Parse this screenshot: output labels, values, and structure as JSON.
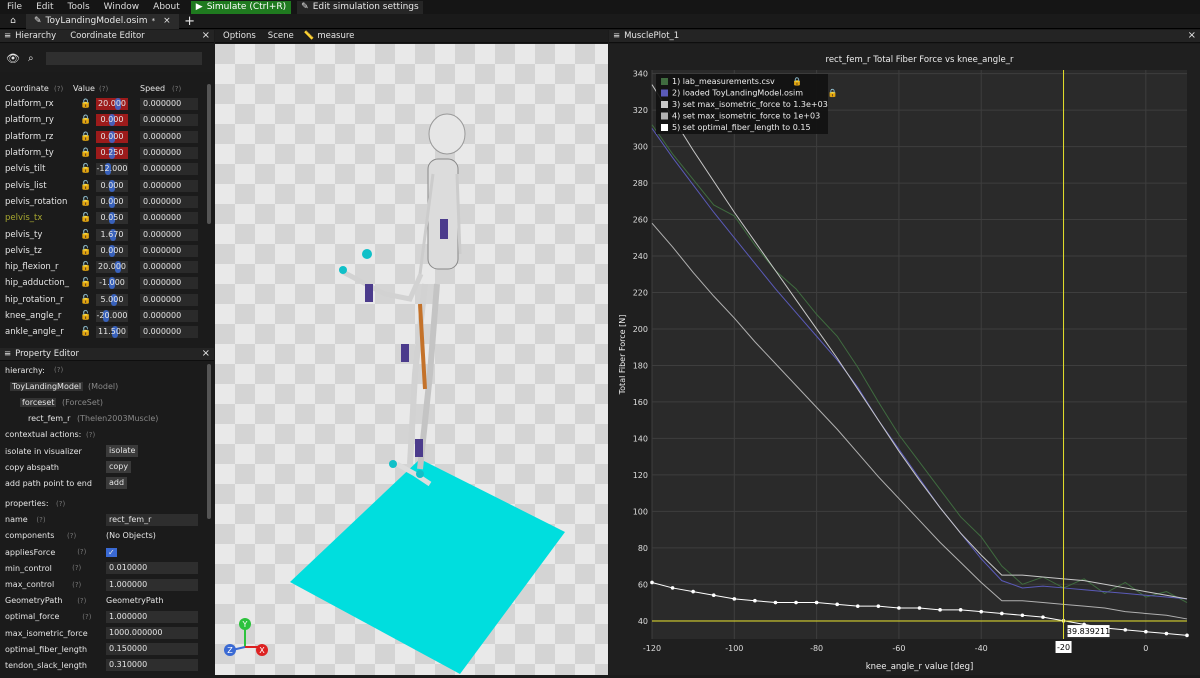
{
  "menu": {
    "items": [
      "File",
      "Edit",
      "Tools",
      "Window",
      "About"
    ],
    "simulate_label": "Simulate (Ctrl+R)",
    "edit_sim_label": "Edit simulation settings"
  },
  "tabs": {
    "file_tab": "ToyLandingModel.osim",
    "modified_mark": "*"
  },
  "hierarchy_panel": {
    "tab1": "Hierarchy",
    "tab2": "Coordinate Editor"
  },
  "coord_editor": {
    "headers": {
      "coordinate": "Coordinate",
      "value": "Value",
      "speed": "Speed",
      "help": "(?)"
    },
    "rows": [
      {
        "name": "platform_rx",
        "value": "20.000",
        "speed": "0.000000",
        "locked": true
      },
      {
        "name": "platform_ry",
        "value": "0.000",
        "speed": "0.000000",
        "locked": true
      },
      {
        "name": "platform_rz",
        "value": "0.000",
        "speed": "0.000000",
        "locked": true
      },
      {
        "name": "platform_ty",
        "value": "0.250",
        "speed": "0.000000",
        "locked": true
      },
      {
        "name": "pelvis_tilt",
        "value": "-12.000",
        "speed": "0.000000",
        "locked": false
      },
      {
        "name": "pelvis_list",
        "value": "0.000",
        "speed": "0.000000",
        "locked": false
      },
      {
        "name": "pelvis_rotation",
        "value": "0.000",
        "speed": "0.000000",
        "locked": false
      },
      {
        "name": "pelvis_tx",
        "value": "0.050",
        "speed": "0.000000",
        "locked": false
      },
      {
        "name": "pelvis_ty",
        "value": "1.670",
        "speed": "0.000000",
        "locked": false
      },
      {
        "name": "pelvis_tz",
        "value": "0.000",
        "speed": "0.000000",
        "locked": false
      },
      {
        "name": "hip_flexion_r",
        "value": "20.000",
        "speed": "0.000000",
        "locked": false
      },
      {
        "name": "hip_adduction_",
        "value": "-1.000",
        "speed": "0.000000",
        "locked": false
      },
      {
        "name": "hip_rotation_r",
        "value": "5.000",
        "speed": "0.000000",
        "locked": false
      },
      {
        "name": "knee_angle_r",
        "value": "-20.000",
        "speed": "0.000000",
        "locked": false
      },
      {
        "name": "ankle_angle_r",
        "value": "11.500",
        "speed": "0.000000",
        "locked": false
      }
    ],
    "colors": {
      "locked_bg": "#9c1b1b",
      "dimmed_name": "#a8a830"
    }
  },
  "property_editor": {
    "title": "Property Editor",
    "hierarchy_label": "hierarchy:",
    "h_model": "ToyLandingModel",
    "h_model_type": "(Model)",
    "h_forceset": "forceset",
    "h_forceset_type": "(ForceSet)",
    "h_muscle": "rect_fem_r",
    "h_muscle_type": "(Thelen2003Muscle)",
    "contextual_label": "contextual actions:",
    "isolate_label": "isolate in visualizer",
    "isolate_btn": "isolate",
    "copy_label": "copy abspath",
    "copy_btn": "copy",
    "addpath_label": "add path point to end",
    "add_btn": "add",
    "properties_label": "properties:",
    "props": [
      {
        "key": "name",
        "value": "rect_fem_r",
        "kind": "field"
      },
      {
        "key": "components",
        "value": "(No Objects)",
        "kind": "text"
      },
      {
        "key": "appliesForce",
        "value": "✓",
        "kind": "check"
      },
      {
        "key": "min_control",
        "value": "0.010000",
        "kind": "field"
      },
      {
        "key": "max_control",
        "value": "1.000000",
        "kind": "field"
      },
      {
        "key": "GeometryPath",
        "value": "GeometryPath",
        "kind": "text"
      },
      {
        "key": "optimal_force",
        "value": "1.000000",
        "kind": "field"
      },
      {
        "key": "max_isometric_force",
        "value": "1000.000000",
        "kind": "field"
      },
      {
        "key": "optimal_fiber_length",
        "value": "0.150000",
        "kind": "field"
      },
      {
        "key": "tendon_slack_length",
        "value": "0.310000",
        "kind": "field"
      }
    ]
  },
  "viewer": {
    "options": "Options",
    "scene": "Scene",
    "measure": "measure",
    "floor_color": "#00dede",
    "axes": {
      "x": "X",
      "y": "Y",
      "z": "Z"
    }
  },
  "plot_panel": {
    "title": "MusclePlot_1",
    "chart_data": {
      "type": "line",
      "title": "rect_fem_r Total Fiber Force vs knee_angle_r",
      "xlabel": "knee_angle_r value [deg]",
      "ylabel": "Total Fiber Force [N]",
      "xlim": [
        -120,
        10
      ],
      "ylim": [
        30,
        342
      ],
      "x_ticks": [
        -120,
        -100,
        -80,
        -60,
        -40,
        -20,
        0
      ],
      "y_ticks": [
        40,
        60,
        80,
        100,
        120,
        140,
        160,
        180,
        200,
        220,
        240,
        260,
        280,
        300,
        320,
        340
      ],
      "grid": true,
      "legend_position": "top-left",
      "crosshair": {
        "x": -20,
        "y": 39.839211,
        "x_label": "-20",
        "y_label": "39.839211"
      },
      "series": [
        {
          "name": "1) lab_measurements.csv",
          "color": "#3f6b3f",
          "locked": true,
          "x": [
            -120,
            -115,
            -110,
            -105,
            -100,
            -95,
            -90,
            -85,
            -80,
            -75,
            -70,
            -65,
            -60,
            -55,
            -50,
            -45,
            -40,
            -35,
            -30,
            -25,
            -20,
            -15,
            -10,
            -5,
            0,
            5,
            10
          ],
          "y": [
            312,
            296,
            282,
            268,
            262,
            246,
            232,
            222,
            208,
            196,
            179,
            160,
            142,
            127,
            112,
            97,
            86,
            70,
            60,
            64,
            58,
            63,
            55,
            61,
            53,
            56,
            50
          ]
        },
        {
          "name": "2) loaded ToyLandingModel.osim",
          "color": "#5a5ab8",
          "locked": true,
          "x": [
            -120,
            -115,
            -110,
            -105,
            -100,
            -95,
            -90,
            -85,
            -80,
            -75,
            -70,
            -65,
            -60,
            -55,
            -50,
            -45,
            -40,
            -35,
            -30,
            -25,
            -20,
            -15,
            -10,
            -5,
            0,
            5,
            10
          ],
          "y": [
            310,
            294,
            279,
            264,
            250,
            236,
            222,
            209,
            196,
            183,
            168,
            150,
            134,
            118,
            102,
            88,
            74,
            62,
            58,
            59,
            58,
            57,
            56,
            55,
            54,
            53,
            52
          ]
        },
        {
          "name": "3) set max_isometric_force to 1.3e+03",
          "color": "#c8c8c8",
          "locked": false,
          "x": [
            -120,
            -115,
            -110,
            -105,
            -100,
            -95,
            -90,
            -85,
            -80,
            -75,
            -70,
            -65,
            -60,
            -55,
            -50,
            -45,
            -40,
            -35,
            -30,
            -25,
            -20,
            -15,
            -10,
            -5,
            0,
            5,
            10
          ],
          "y": [
            334,
            316,
            298,
            281,
            264,
            248,
            232,
            216,
            200,
            184,
            167,
            150,
            133,
            117,
            102,
            88,
            76,
            65,
            65,
            64,
            63,
            62,
            60,
            58,
            56,
            54,
            52
          ]
        },
        {
          "name": "4) set max_isometric_force to 1e+03",
          "color": "#b0b0b0",
          "locked": false,
          "x": [
            -120,
            -115,
            -110,
            -105,
            -100,
            -95,
            -90,
            -85,
            -80,
            -75,
            -70,
            -65,
            -60,
            -55,
            -50,
            -45,
            -40,
            -35,
            -30,
            -25,
            -20,
            -15,
            -10,
            -5,
            0,
            5,
            10
          ],
          "y": [
            258,
            245,
            231,
            218,
            206,
            193,
            181,
            169,
            157,
            145,
            132,
            119,
            107,
            95,
            83,
            72,
            61,
            51,
            51,
            50,
            49,
            48,
            47,
            45,
            44,
            43,
            41
          ]
        },
        {
          "name": "5) set optimal_fiber_length to 0.15",
          "color": "#ffffff",
          "locked": false,
          "x": [
            -120,
            -115,
            -110,
            -105,
            -100,
            -95,
            -90,
            -85,
            -80,
            -75,
            -70,
            -65,
            -60,
            -55,
            -50,
            -45,
            -40,
            -35,
            -30,
            -25,
            -20,
            -15,
            -10,
            -5,
            0,
            5,
            10
          ],
          "y": [
            61,
            58,
            56,
            54,
            52,
            51,
            50,
            50,
            50,
            49,
            48,
            48,
            47,
            47,
            46,
            46,
            45,
            44,
            43,
            42,
            40,
            38,
            36,
            35,
            34,
            33,
            32
          ]
        }
      ]
    }
  }
}
